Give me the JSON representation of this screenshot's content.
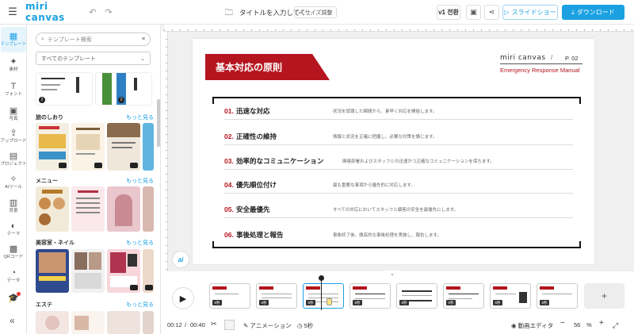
{
  "app": {
    "logo": "miri canvas",
    "doc_title": "タイトルを入力してく...",
    "size_button": "サイズ調整",
    "version": "v1 전환",
    "slideshow": "スライドショー",
    "download": "ダウンロード"
  },
  "rail": [
    {
      "icon": "▦",
      "label": "テンプレート",
      "active": true
    },
    {
      "icon": "✦",
      "label": "素材"
    },
    {
      "icon": "T",
      "label": "フォント"
    },
    {
      "icon": "▣",
      "label": "写真"
    },
    {
      "icon": "⇪",
      "label": "アップロード"
    },
    {
      "icon": "▤",
      "label": "プロジェクト"
    },
    {
      "icon": "✧",
      "label": "AIツール"
    },
    {
      "icon": "▥",
      "label": "背景"
    },
    {
      "icon": "◐",
      "label": "テーマ"
    },
    {
      "icon": "▩",
      "label": "QRコード"
    },
    {
      "icon": "◔",
      "label": "データ"
    }
  ],
  "panel": {
    "search_placeholder": "テンプレート検索",
    "filter_value": "すべてのテンプレート",
    "sections": [
      {
        "title": "旅のしおり",
        "more": "もっと見る"
      },
      {
        "title": "メニュー",
        "more": "もっと見る"
      },
      {
        "title": "美容室・ネイル",
        "more": "もっと見る"
      },
      {
        "title": "エステ",
        "more": "もっと見る"
      }
    ]
  },
  "slide": {
    "title": "基本対応の原則",
    "brand": "miri canvas",
    "slash": "/",
    "page": "P. 02",
    "subtitle": "Emergency Response Manual",
    "rows": [
      {
        "num": "01.",
        "title": "迅速な対応",
        "desc": "状況を認識した瞬間から、素早く対応を開始します。"
      },
      {
        "num": "02.",
        "title": "正確性の維持",
        "desc": "情報と状況を正確に把握し、必要な対策を講じます。"
      },
      {
        "num": "03.",
        "title": "効率的なコミュニケーション",
        "desc": "関連部署およびスタッフとの迅速かつ正確なコミュニケーションを保ちます。"
      },
      {
        "num": "04.",
        "title": "優先順位付け",
        "desc": "最も重要な事項から優先的に対応します。"
      },
      {
        "num": "05.",
        "title": "安全最優先",
        "desc": "すべての対応においてスタッフと顧客の安全を最優先にします。"
      },
      {
        "num": "06.",
        "title": "事後処理と報告",
        "desc": "事象終了後、徹底的な事後処理を実施し、報告します。"
      }
    ]
  },
  "timeline": {
    "thumb_duration": "5秒",
    "add": "+"
  },
  "bottombar": {
    "time_current": "00:12",
    "time_sep": "/",
    "time_total": "00:40",
    "animation": "アニメーション",
    "duration": "5秒",
    "video_editor": "動画エディタ",
    "zoom": "56",
    "zoom_unit": "%"
  }
}
